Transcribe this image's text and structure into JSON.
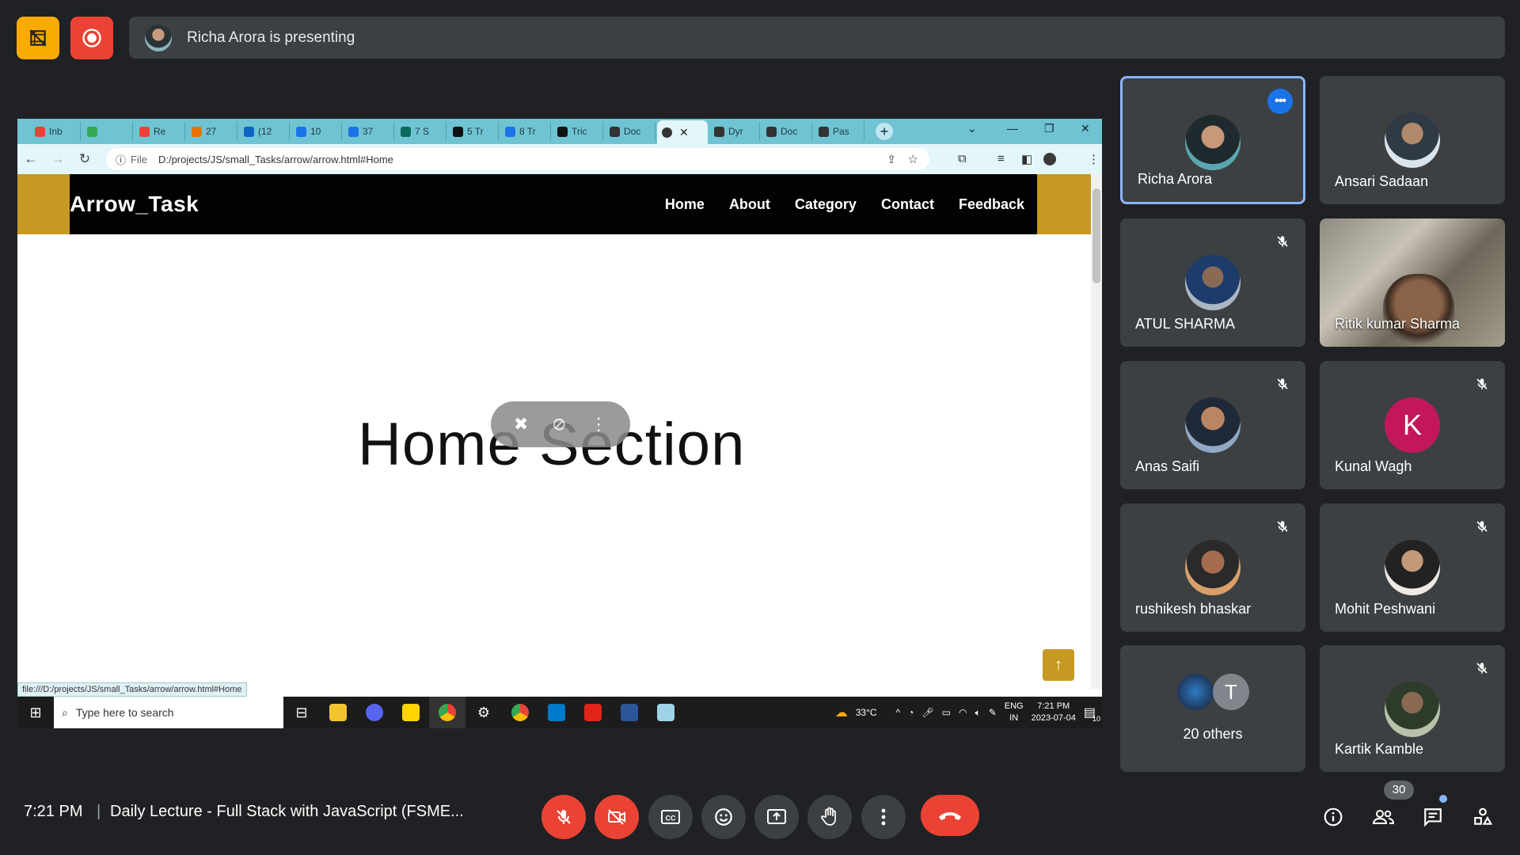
{
  "presenting": {
    "text": "Richa Arora is presenting"
  },
  "browser": {
    "tabs": [
      {
        "label": "Inb",
        "color": "#ea4335"
      },
      {
        "label": "",
        "color": "#34a853"
      },
      {
        "label": "Re",
        "color": "#ea4335"
      },
      {
        "label": "27",
        "color": "#e8710a"
      },
      {
        "label": "(12",
        "color": "#0a66c2"
      },
      {
        "label": "10",
        "color": "#1a73e8"
      },
      {
        "label": "37",
        "color": "#1a73e8"
      },
      {
        "label": "7 S",
        "color": "#0d6b5e"
      },
      {
        "label": "5 Tr",
        "color": "#111111"
      },
      {
        "label": "8 Tr",
        "color": "#1a73e8"
      },
      {
        "label": "Tric",
        "color": "#111111"
      },
      {
        "label": "Doc",
        "color": "#333333"
      }
    ],
    "tabs_after": [
      {
        "label": "Dyr",
        "color": "#333333"
      },
      {
        "label": "Doc",
        "color": "#333333"
      },
      {
        "label": "Pas",
        "color": "#333333"
      }
    ],
    "file_label": "File",
    "url": "D:/projects/JS/small_Tasks/arrow/arrow.html#Home",
    "status_url": "file:///D:/projects/JS/small_Tasks/arrow/arrow.html#Home"
  },
  "site": {
    "brand": "Arrow_Task",
    "menu": [
      "Home",
      "About",
      "Category",
      "Contact",
      "Feedback"
    ],
    "hero": "Home Section"
  },
  "taskbar": {
    "search_placeholder": "Type here to search",
    "weather": "33°C",
    "lang": "ENG",
    "region": "IN",
    "time": "7:21 PM",
    "date": "2023-07-04",
    "notif_count": "10"
  },
  "participants": [
    {
      "name": "Richa Arora",
      "initial": "",
      "muted": false,
      "active": true
    },
    {
      "name": "Ansari Sadaan",
      "initial": "",
      "muted": false,
      "active": false
    },
    {
      "name": "ATUL SHARMA",
      "initial": "",
      "muted": true,
      "active": false
    },
    {
      "name": "Ritik kumar Sharma",
      "initial": "",
      "muted": false,
      "active": false
    },
    {
      "name": "Anas Saifi",
      "initial": "",
      "muted": true,
      "active": false
    },
    {
      "name": "Kunal Wagh",
      "initial": "K",
      "muted": true,
      "active": false
    },
    {
      "name": "rushikesh bhaskar",
      "initial": "",
      "muted": true,
      "active": false
    },
    {
      "name": "Mohit Peshwani",
      "initial": "",
      "muted": true,
      "active": false
    },
    {
      "name": "Kartik Kamble",
      "initial": "",
      "muted": true,
      "active": false
    }
  ],
  "others": {
    "label": "20 others",
    "initial": "T"
  },
  "meeting": {
    "time": "7:21 PM",
    "separator": "|",
    "title": "Daily Lecture - Full Stack with JavaScript (FSME...",
    "people_count": "30"
  },
  "colors": {
    "accent": "#8ab4f8",
    "danger": "#ea4335",
    "tile": "#3c4043",
    "background": "#202124",
    "site_gold": "#c69a22"
  }
}
